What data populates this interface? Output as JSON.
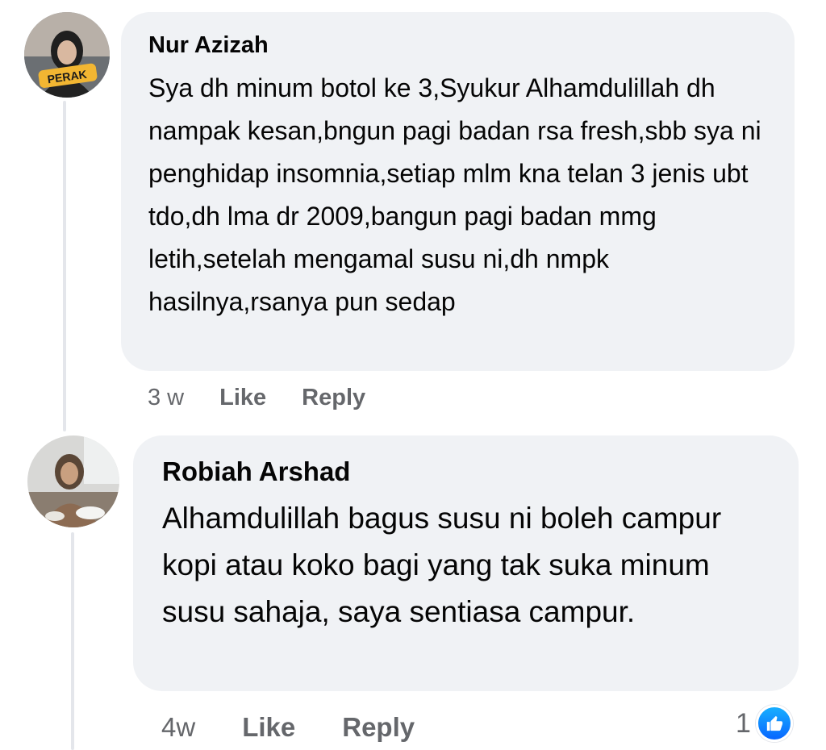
{
  "comments": [
    {
      "author": "Nur Azizah",
      "avatar_badge": "PERAK",
      "text": "Sya dh minum botol ke 3,Syukur Alhamdulillah dh nampak kesan,bngun pagi badan rsa fresh,sbb sya ni penghidap insomnia,setiap mlm kna telan 3 jenis ubt tdo,dh lma dr 2009,bangun pagi badan mmg letih,setelah mengamal susu ni,dh nmpk hasilnya,rsanya pun sedap",
      "time": "3 w",
      "like_label": "Like",
      "reply_label": "Reply"
    },
    {
      "author": "Robiah Arshad",
      "text": "Alhamdulillah bagus susu ni boleh campur kopi atau koko bagi yang tak suka minum susu sahaja, saya sentiasa campur.",
      "time": "4w",
      "like_label": "Like",
      "reply_label": "Reply",
      "reaction_count": "1",
      "reaction_icon": "thumbs-up-icon"
    }
  ],
  "colors": {
    "bubble": "#f0f2f5",
    "action_text": "#65676b",
    "like_blue": "#0866ff"
  }
}
